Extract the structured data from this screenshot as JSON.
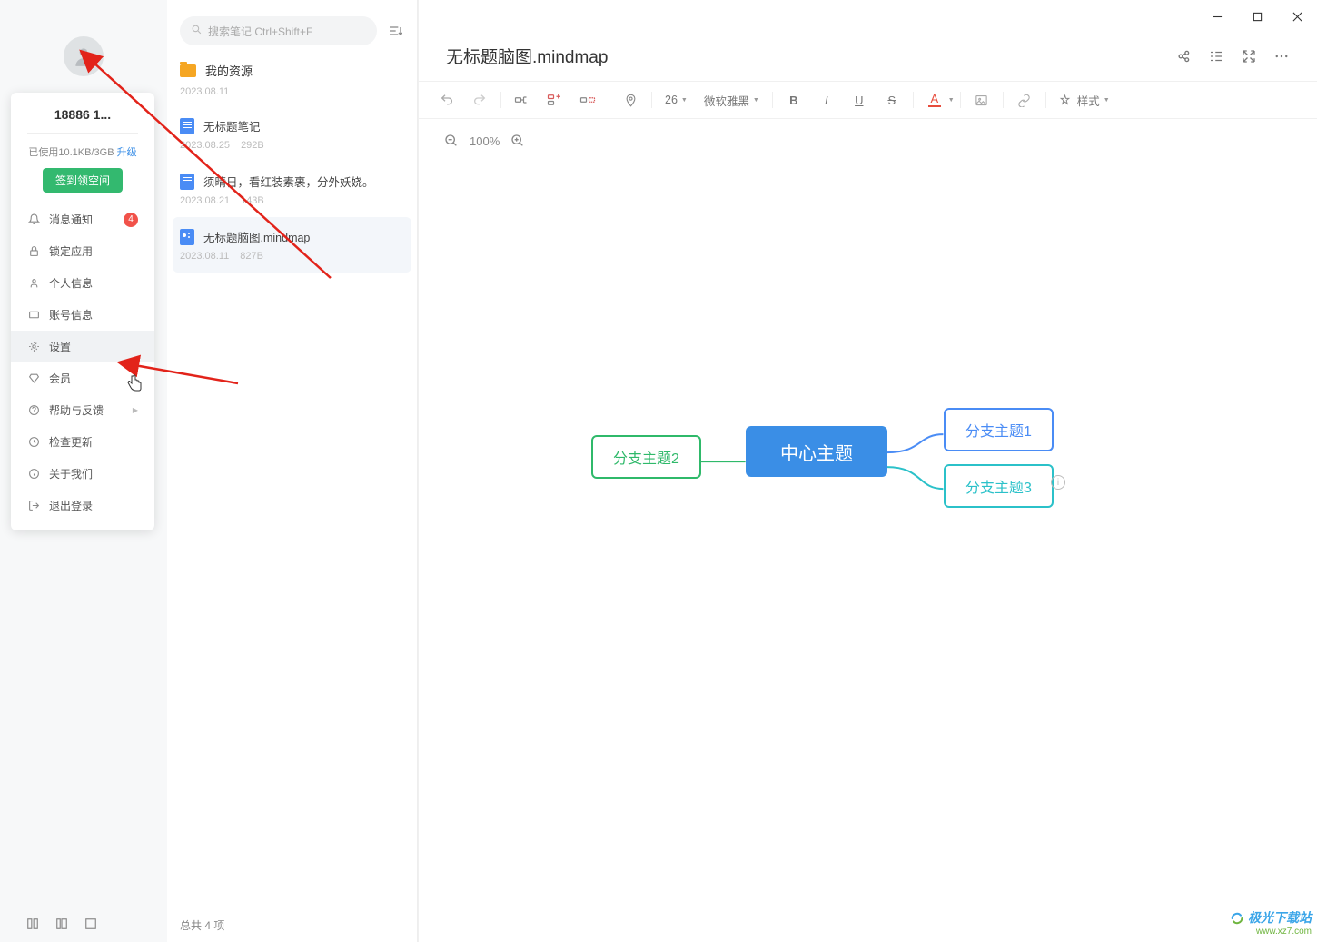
{
  "user": {
    "name": "18886 1...",
    "storage_prefix": "已使用10.1KB/3GB ",
    "upgrade": "升级",
    "signin_button": "签到领空间"
  },
  "menu": {
    "items": [
      {
        "label": "消息通知",
        "badge": "4"
      },
      {
        "label": "锁定应用"
      },
      {
        "label": "个人信息"
      },
      {
        "label": "账号信息"
      },
      {
        "label": "设置"
      },
      {
        "label": "会员"
      },
      {
        "label": "帮助与反馈",
        "chevron": true
      },
      {
        "label": "检查更新"
      },
      {
        "label": "关于我们"
      },
      {
        "label": "退出登录"
      }
    ]
  },
  "search": {
    "placeholder": "搜索笔记 Ctrl+Shift+F"
  },
  "folder": {
    "name": "我的资源",
    "date": "2023.08.11"
  },
  "files": [
    {
      "title": "无标题笔记",
      "date": "2023.08.25",
      "size": "292B",
      "type": "doc"
    },
    {
      "title": "须晴日，看红装素裹，分外妖娆。",
      "date": "2023.08.21",
      "size": "143B",
      "type": "doc"
    },
    {
      "title": "无标题脑图.mindmap",
      "date": "2023.08.11",
      "size": "827B",
      "type": "mindmap"
    }
  ],
  "file_footer": "总共 4 项",
  "doc": {
    "title": "无标题脑图.mindmap",
    "font_size": "26",
    "font_family": "微软雅黑",
    "style_label": "样式",
    "zoom": "100%"
  },
  "mindmap": {
    "center": "中心主题",
    "left": "分支主题2",
    "r1": "分支主题1",
    "r2": "分支主题3"
  },
  "watermark": {
    "top": "极光下载站",
    "bottom": "www.xz7.com"
  }
}
